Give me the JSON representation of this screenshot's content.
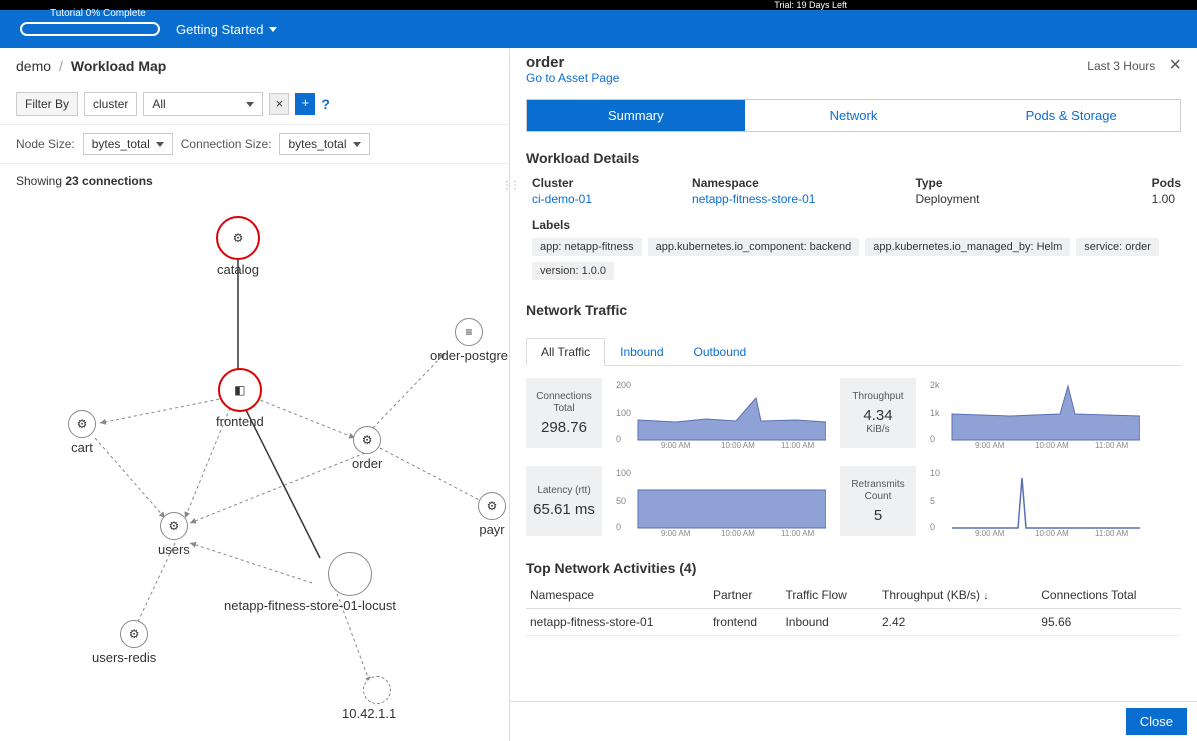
{
  "trial_text": "Trial: 19 Days Left",
  "tutorial": {
    "label": "Tutorial 0% Complete",
    "getting_started": "Getting Started"
  },
  "breadcrumb": {
    "root": "demo",
    "current": "Workload Map"
  },
  "filters": {
    "filter_by": "Filter By",
    "key": "cluster",
    "value": "All",
    "help": "?"
  },
  "sizes": {
    "node_label": "Node Size:",
    "node_value": "bytes_total",
    "conn_label": "Connection Size:",
    "conn_value": "bytes_total"
  },
  "showing": {
    "prefix": "Showing ",
    "count": "23 connections"
  },
  "nodes": {
    "catalog": "catalog",
    "frontend": "frontend",
    "cart": "cart",
    "order": "order",
    "order_postgres": "order-postgre",
    "users": "users",
    "payment": "payr",
    "locust": "netapp-fitness-store-01-locust",
    "users_redis": "users-redis",
    "ip": "10.42.1.1"
  },
  "panel": {
    "title": "order",
    "asset_link": "Go to Asset Page",
    "time_range": "Last 3 Hours",
    "tabs": {
      "summary": "Summary",
      "network": "Network",
      "pods": "Pods & Storage"
    },
    "details_title": "Workload Details",
    "details": {
      "cluster_label": "Cluster",
      "cluster_value": "ci-demo-01",
      "namespace_label": "Namespace",
      "namespace_value": "netapp-fitness-store-01",
      "type_label": "Type",
      "type_value": "Deployment",
      "pods_label": "Pods",
      "pods_value": "1.00"
    },
    "labels_title": "Labels",
    "labels": [
      "app: netapp-fitness",
      "app.kubernetes.io_component: backend",
      "app.kubernetes.io_managed_by: Helm",
      "service: order",
      "version: 1.0.0"
    ],
    "network_title": "Network Traffic",
    "subtabs": {
      "all": "All Traffic",
      "inbound": "Inbound",
      "outbound": "Outbound"
    },
    "metrics": {
      "connections": {
        "title": "Connections Total",
        "value": "298.76"
      },
      "throughput": {
        "title": "Throughput",
        "value": "4.34",
        "unit": "KiB/s"
      },
      "latency": {
        "title": "Latency (rtt)",
        "value": "65.61 ms"
      },
      "retransmits": {
        "title": "Retransmits Count",
        "value": "5"
      }
    },
    "time_ticks": [
      "9:00 AM",
      "10:00 AM",
      "11:00 AM"
    ],
    "y_ticks_a": [
      "200",
      "100",
      "0"
    ],
    "y_ticks_b": [
      "2k",
      "1k",
      "0"
    ],
    "y_ticks_c": [
      "100",
      "50",
      "0"
    ],
    "y_ticks_d": [
      "10",
      "5",
      "0"
    ],
    "activities_title": "Top Network Activities (4)",
    "activities_cols": {
      "ns": "Namespace",
      "partner": "Partner",
      "flow": "Traffic Flow",
      "tput": "Throughput (KB/s)",
      "conn": "Connections Total"
    },
    "activities_rows": [
      {
        "ns": "netapp-fitness-store-01",
        "partner": "frontend",
        "flow": "Inbound",
        "tput": "2.42",
        "conn": "95.66"
      }
    ],
    "close": "Close"
  },
  "chart_data": [
    {
      "type": "area",
      "title": "Connections Total",
      "ylim": [
        0,
        200
      ],
      "x_ticks": [
        "9:00 AM",
        "10:00 AM",
        "11:00 AM"
      ],
      "baseline": 80,
      "spike_x": 0.65,
      "spike_y": 150
    },
    {
      "type": "area",
      "title": "Throughput KiB/s",
      "ylim": [
        0,
        2000
      ],
      "x_ticks": [
        "9:00 AM",
        "10:00 AM",
        "11:00 AM"
      ],
      "baseline": 900,
      "spike_x": 0.65,
      "spike_y": 1900
    },
    {
      "type": "area",
      "title": "Latency ms",
      "ylim": [
        0,
        100
      ],
      "x_ticks": [
        "9:00 AM",
        "10:00 AM",
        "11:00 AM"
      ],
      "baseline": 65,
      "spike_x": null,
      "spike_y": null
    },
    {
      "type": "line",
      "title": "Retransmits",
      "ylim": [
        0,
        10
      ],
      "x_ticks": [
        "9:00 AM",
        "10:00 AM",
        "11:00 AM"
      ],
      "baseline": 0,
      "spike_x": 0.35,
      "spike_y": 9
    }
  ]
}
